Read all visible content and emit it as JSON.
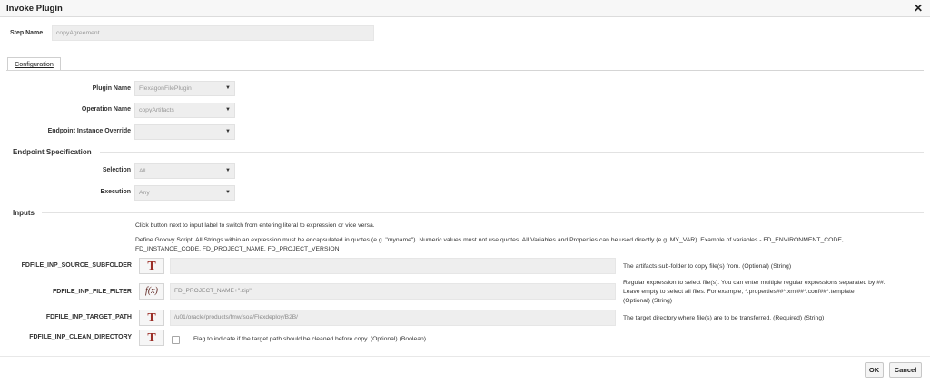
{
  "dialog": {
    "title": "Invoke Plugin",
    "close_glyph": "✕"
  },
  "step": {
    "label": "Step Name",
    "value": "copyAgreement"
  },
  "tabs": [
    {
      "label": "Configuration"
    }
  ],
  "config": {
    "plugin_name": {
      "label": "Plugin Name",
      "value": "FlexagonFilePlugin"
    },
    "operation_name": {
      "label": "Operation Name",
      "value": "copyArtifacts"
    },
    "endpoint_override": {
      "label": "Endpoint Instance Override",
      "value": ""
    }
  },
  "endpoint_spec": {
    "heading": "Endpoint Specification",
    "selection": {
      "label": "Selection",
      "value": "All"
    },
    "execution": {
      "label": "Execution",
      "value": "Any"
    }
  },
  "inputs": {
    "heading": "Inputs",
    "hint": "Click button next to input label to switch from entering literal to expression or vice versa.",
    "groovy_hint_1": "Define Groovy Script. All Strings within an expression must be encapsulated in quotes (e.g. \"myname\"). Numeric values must not use quotes. All Variables and Properties can be used directly (e.g. MY_VAR). Example of variables - FD_ENVIRONMENT_CODE,",
    "groovy_hint_2": "FD_INSTANCE_CODE, FD_PROJECT_NAME, FD_PROJECT_VERSION",
    "rows": [
      {
        "label": "FDFILE_INP_SOURCE_SUBFOLDER",
        "mode": "T",
        "value": "",
        "help": "The artifacts sub-folder to copy file(s) from. (Optional) (String)"
      },
      {
        "label": "FDFILE_INP_FILE_FILTER",
        "mode": "f(x)",
        "value": "FD_PROJECT_NAME+\".zip\"",
        "help_1": "Regular expression to select file(s). You can enter multiple regular expressions separated by ##.",
        "help_2": "Leave empty to select all files. For example, *.properties##*.xml##*.conf##*.template",
        "help_3": "(Optional) (String)"
      },
      {
        "label": "FDFILE_INP_TARGET_PATH",
        "mode": "T",
        "value": "/u01/oracle/products/fmw/soa/Flexdeploy/B2B/",
        "help": "The target directory where file(s) are to be transferred. (Required) (String)"
      },
      {
        "label": "FDFILE_INP_CLEAN_DIRECTORY",
        "mode": "T",
        "checked": false,
        "help": "Flag to indicate if the target path should be cleaned before copy. (Optional) (Boolean)"
      }
    ]
  },
  "footer": {
    "ok": "OK",
    "cancel": "Cancel"
  },
  "caret_glyph": "▼"
}
